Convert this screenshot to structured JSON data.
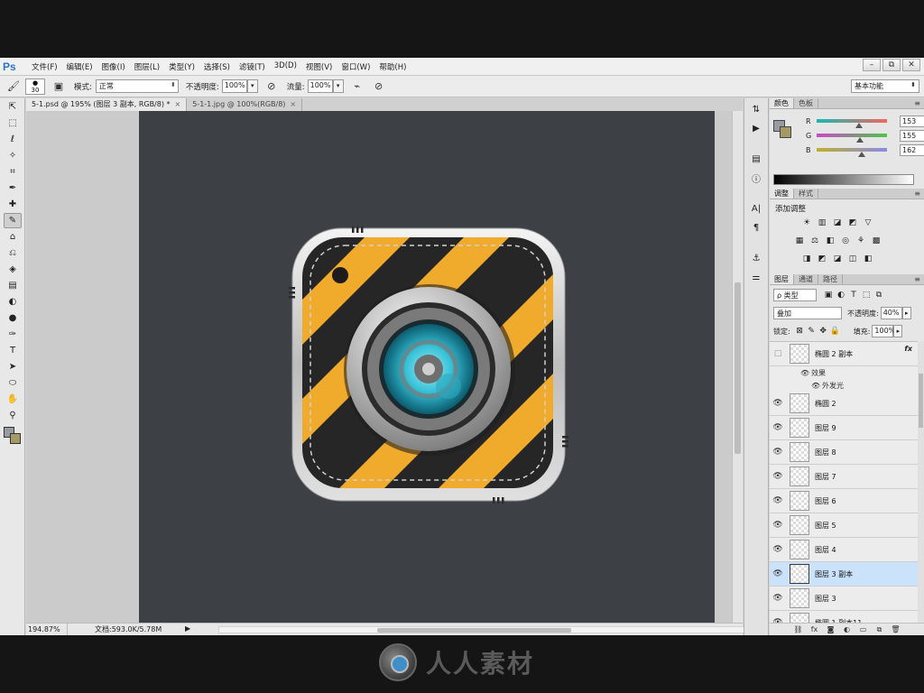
{
  "app": {
    "logo": "Ps",
    "menu": [
      "文件(F)",
      "编辑(E)",
      "图像(I)",
      "图层(L)",
      "类型(Y)",
      "选择(S)",
      "滤镜(T)",
      "3D(D)",
      "视图(V)",
      "窗口(W)",
      "帮助(H)"
    ],
    "window_controls": [
      "–",
      "⧉",
      "✕"
    ]
  },
  "options": {
    "brush_size": "30",
    "mode_label": "模式:",
    "mode_value": "正常",
    "opacity_label": "不透明度:",
    "opacity_value": "100%",
    "flow_label": "流量:",
    "flow_value": "100%",
    "workspace": "基本功能"
  },
  "tabs": [
    {
      "label": "5-1.psd @ 195% (图层 3 副本, RGB/8) *",
      "close": "×"
    },
    {
      "label": "5-1-1.jpg @ 100%(RGB/8)",
      "close": "×"
    }
  ],
  "status": {
    "zoom": "194.87%",
    "doc": "文档:593.0K/5.78M"
  },
  "color_panel": {
    "tabs": [
      "颜色",
      "色板"
    ],
    "channels": [
      {
        "label": "R",
        "value": "153",
        "level": 0.6,
        "gradient": [
          "#19b8b1",
          "#f2665e"
        ]
      },
      {
        "label": "G",
        "value": "155",
        "level": 0.61,
        "gradient": [
          "#c94bc4",
          "#4dc64a"
        ]
      },
      {
        "label": "B",
        "value": "162",
        "level": 0.64,
        "gradient": [
          "#bdb02b",
          "#8a8ae8"
        ]
      }
    ],
    "foreground": "#999ba2",
    "background": "#a59a66"
  },
  "adjust_panel": {
    "tabs": [
      "调整",
      "样式"
    ],
    "title": "添加调整",
    "row1": [
      "☀",
      "▥",
      "◪",
      "◩",
      "▽"
    ],
    "row2": [
      "▦",
      "⚖",
      "◧",
      "◎",
      "⚘",
      "▩"
    ],
    "row3": [
      "◨",
      "◩",
      "◪",
      "◫",
      "◧"
    ]
  },
  "layers_panel": {
    "tabs": [
      "图层",
      "通道",
      "路径"
    ],
    "filter": "ρ 类型",
    "filter_icons": [
      "▣",
      "◐",
      "T",
      "⬚",
      "⧉"
    ],
    "blend_mode": "叠加",
    "opacity_label": "不透明度:",
    "opacity": "40%",
    "lock_label": "锁定:",
    "lock_icons": [
      "⊠",
      "✎",
      "✥",
      "🔒"
    ],
    "fill_label": "填充:",
    "fill": "100%",
    "layers": [
      {
        "name": "椭圆 2 副本",
        "visible": false,
        "fx": "fx",
        "selected": false
      },
      {
        "name": "椭圆 2",
        "visible": true,
        "fx": "",
        "selected": false
      },
      {
        "name": "图层 9",
        "visible": true,
        "fx": "",
        "selected": false
      },
      {
        "name": "图层 8",
        "visible": true,
        "fx": "",
        "selected": false
      },
      {
        "name": "图层 7",
        "visible": true,
        "fx": "",
        "selected": false
      },
      {
        "name": "图层 6",
        "visible": true,
        "fx": "",
        "selected": false
      },
      {
        "name": "图层 5",
        "visible": true,
        "fx": "",
        "selected": false
      },
      {
        "name": "图层 4",
        "visible": true,
        "fx": "",
        "selected": false
      },
      {
        "name": "图层 3 副本",
        "visible": true,
        "fx": "",
        "selected": true
      },
      {
        "name": "图层 3",
        "visible": true,
        "fx": "",
        "selected": false
      },
      {
        "name": "椭圆 1 副本11",
        "visible": true,
        "fx": "",
        "selected": false
      }
    ],
    "effects_label": "效果",
    "outer_glow_label": "外发光",
    "footer_icons": [
      "⛓",
      "fx",
      "◙",
      "◐",
      "▭",
      "⧉",
      "🗑"
    ]
  },
  "tools": [
    "⇱",
    "⬚",
    "ℓ",
    "✧",
    "⌗",
    "✒",
    "✚",
    "✎",
    "⌂",
    "⎌",
    "◈",
    "▤",
    "◐",
    "●",
    "✑",
    "T",
    "➤",
    "⬭",
    "✋",
    "⚲"
  ],
  "strip_icons": [
    "⇅",
    "▶",
    "▤",
    "ⓘ",
    "A|",
    "¶",
    "⚓",
    "⚌"
  ],
  "watermark": "人人素材",
  "colors": {
    "artboard": "#3d4146",
    "stripe_yellow": "#f0aa2c",
    "stripe_dark": "#2a2a2a",
    "lens_cyan": "#37c2d8"
  }
}
